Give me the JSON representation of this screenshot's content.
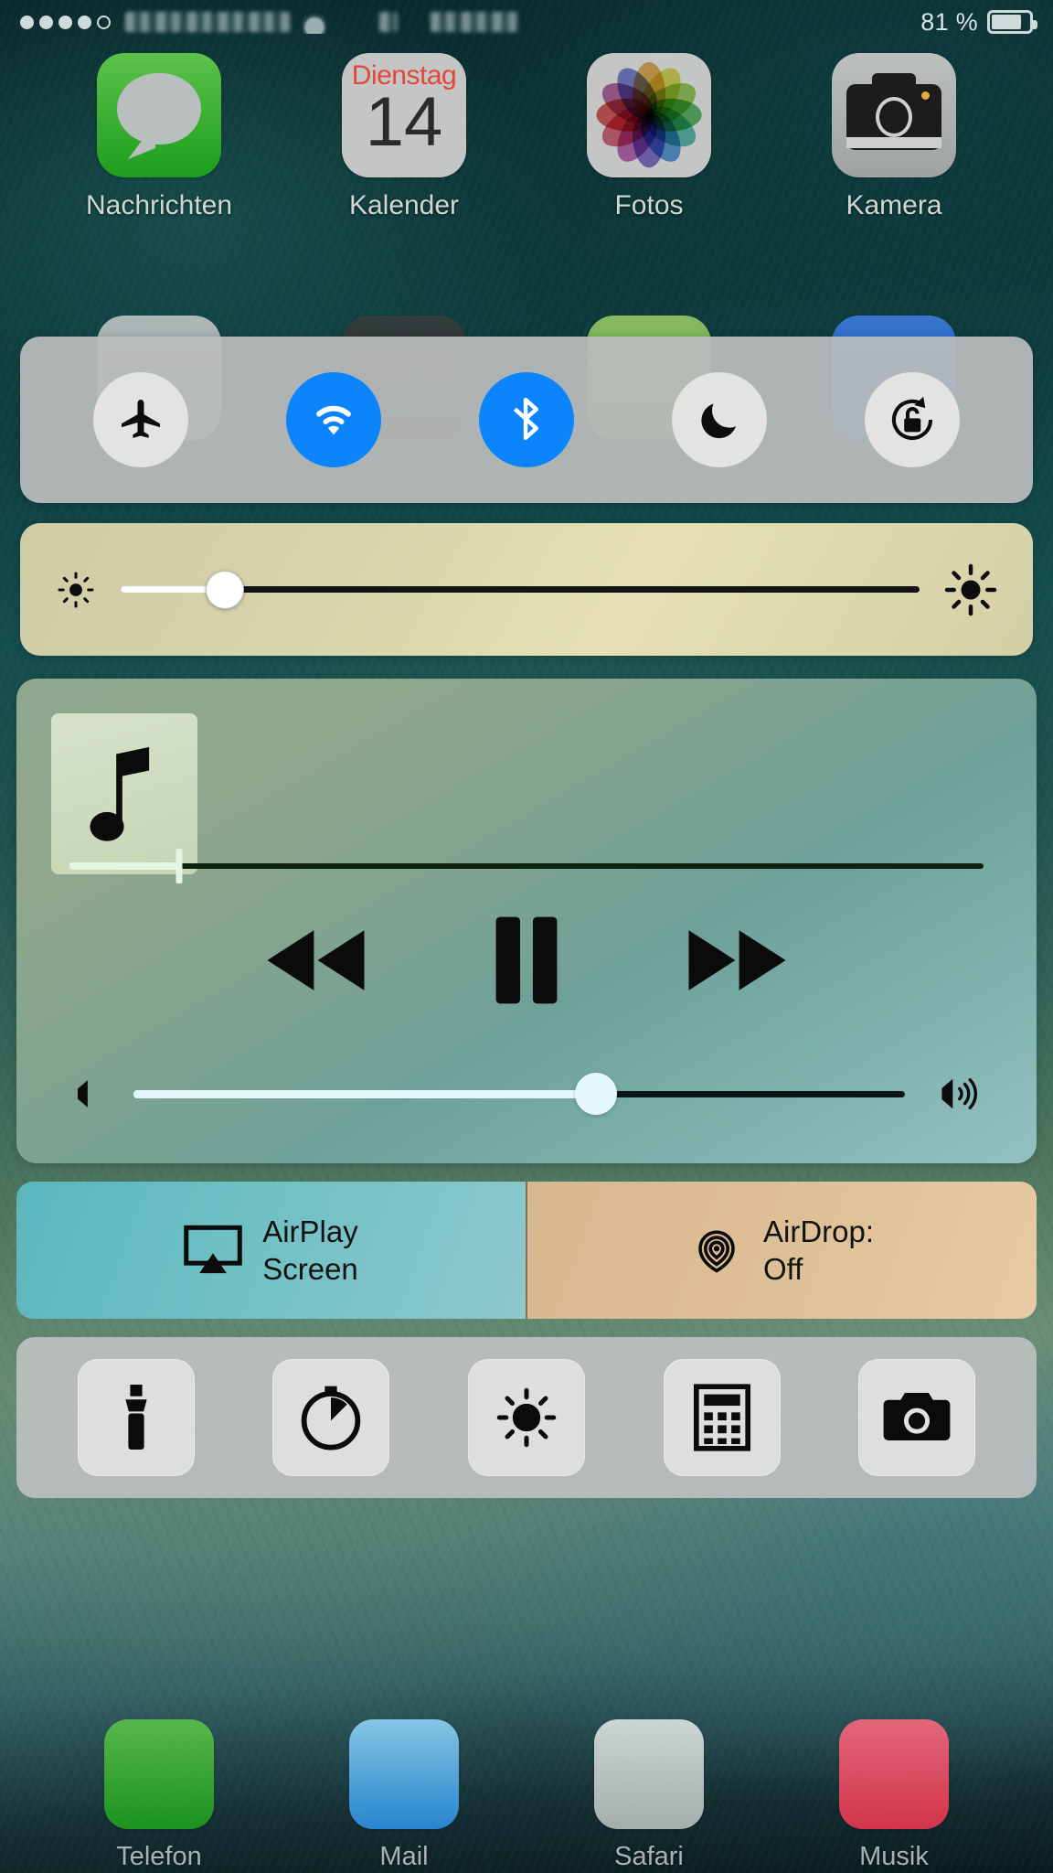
{
  "status_bar": {
    "signal_dots_total": 5,
    "signal_dots_filled": 4,
    "carrier": "",
    "time": "",
    "battery_percent_label": "81 %",
    "battery_level": 81
  },
  "home_apps": [
    {
      "label": "Nachrichten",
      "icon": "messages-icon"
    },
    {
      "label": "Kalender",
      "icon": "calendar-icon",
      "weekday": "Dienstag",
      "day": "14"
    },
    {
      "label": "Fotos",
      "icon": "photos-icon"
    },
    {
      "label": "Kamera",
      "icon": "camera-icon"
    }
  ],
  "dock_apps": [
    {
      "label": "Telefon",
      "icon": "phone-icon"
    },
    {
      "label": "Mail",
      "icon": "mail-icon"
    },
    {
      "label": "Safari",
      "icon": "safari-icon"
    },
    {
      "label": "Musik",
      "icon": "music-icon"
    }
  ],
  "control_center": {
    "toggles": [
      {
        "name": "airplane-mode",
        "icon": "airplane-icon",
        "state": "off"
      },
      {
        "name": "wifi",
        "icon": "wifi-icon",
        "state": "on"
      },
      {
        "name": "bluetooth",
        "icon": "bluetooth-icon",
        "state": "on"
      },
      {
        "name": "do-not-disturb",
        "icon": "moon-icon",
        "state": "off"
      },
      {
        "name": "rotation-lock",
        "icon": "rotation-lock-icon",
        "state": "off"
      }
    ],
    "brightness": {
      "value_percent": 13,
      "min_icon": "brightness-low-icon",
      "max_icon": "brightness-high-icon"
    },
    "music": {
      "album_art_icon": "music-note-icon",
      "progress_percent": 12,
      "controls": [
        {
          "name": "rewind-button",
          "icon": "rewind-icon"
        },
        {
          "name": "pause-button",
          "icon": "pause-icon"
        },
        {
          "name": "fast-forward-button",
          "icon": "fast-forward-icon"
        }
      ],
      "volume": {
        "value_percent": 60,
        "min_icon": "volume-low-icon",
        "max_icon": "volume-high-icon"
      }
    },
    "airplay": {
      "icon": "airplay-icon",
      "line1": "AirPlay",
      "line2": "Screen"
    },
    "airdrop": {
      "icon": "airdrop-icon",
      "line1": "AirDrop:",
      "line2": "Off"
    },
    "shortcuts": [
      {
        "name": "flashlight",
        "icon": "flashlight-icon"
      },
      {
        "name": "timer",
        "icon": "timer-icon"
      },
      {
        "name": "night-shift",
        "icon": "night-shift-icon"
      },
      {
        "name": "calculator",
        "icon": "calculator-icon"
      },
      {
        "name": "camera",
        "icon": "camera-shortcut-icon"
      }
    ]
  },
  "colors": {
    "toggle_on": "#0b84fe",
    "toggle_off": "#e3e3e1",
    "calendar_weekday": "#e2483a",
    "airplay_panel": "#6fc0c4",
    "airdrop_panel": "#dfc197"
  }
}
